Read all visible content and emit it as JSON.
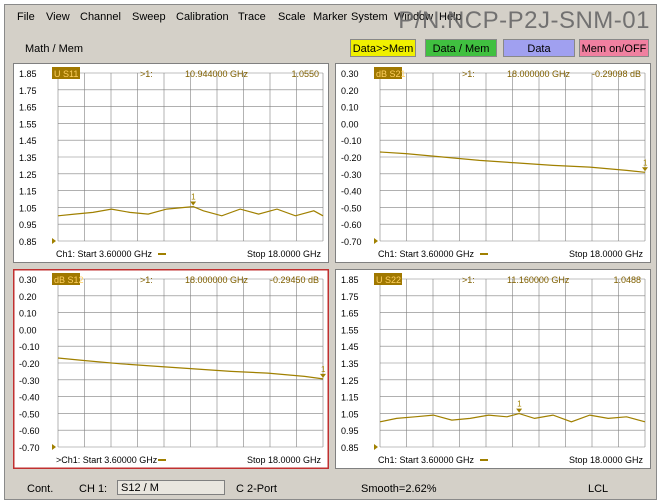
{
  "menu": [
    "File",
    "View",
    "Channel",
    "Sweep",
    "Calibration",
    "Trace",
    "Scale",
    "Marker",
    "System",
    "Window",
    "Help"
  ],
  "watermark": "P/N:NCP-P2J-SNM-01",
  "toolbar": {
    "label": "Math / Mem",
    "buttons": [
      {
        "label": "Data>>Mem",
        "color": "#f0f000"
      },
      {
        "label": "Data / Mem",
        "color": "#40c040"
      },
      {
        "label": "Data",
        "color": "#a0a0f0"
      },
      {
        "label": "Mem on/OFF",
        "color": "#f080a0"
      }
    ]
  },
  "panels": [
    {
      "trace_label": "U S11",
      "marker_text": ">1:",
      "marker_freq": "10.944000 GHz",
      "marker_value": "1.0550",
      "y_ticks": [
        "1.85",
        "1.75",
        "1.65",
        "1.55",
        "1.45",
        "1.35",
        "1.25",
        "1.15",
        "1.05",
        "0.95",
        "0.85"
      ],
      "start": "Ch1: Start  3.60000 GHz",
      "stop": "Stop  18.0000 GHz",
      "selected": false,
      "trace": {
        "x": [
          3.6,
          4.5,
          5.5,
          6.5,
          7.5,
          8.5,
          9.5,
          10.5,
          10.944,
          11.5,
          12.5,
          13.5,
          14.5,
          15.5,
          16.5,
          17.5,
          18.0
        ],
        "y": [
          1.0,
          1.01,
          1.02,
          1.04,
          1.02,
          1.01,
          1.04,
          1.05,
          1.055,
          1.03,
          1.0,
          1.04,
          1.01,
          1.04,
          1.0,
          1.03,
          1.0
        ]
      },
      "ylim": [
        0.85,
        1.85
      ],
      "marker_x": 10.944
    },
    {
      "trace_label": "dB S21",
      "marker_text": ">1:",
      "marker_freq": "18.000000 GHz",
      "marker_value": "-0.29098 dB",
      "y_ticks": [
        "0.30",
        "0.20",
        "0.10",
        "0.00",
        "-0.10",
        "-0.20",
        "-0.30",
        "-0.40",
        "-0.50",
        "-0.60",
        "-0.70"
      ],
      "start": "Ch1: Start  3.60000 GHz",
      "stop": "Stop  18.0000 GHz",
      "selected": false,
      "trace": {
        "x": [
          3.6,
          5,
          7,
          9,
          11,
          13,
          15,
          17,
          18.0
        ],
        "y": [
          -0.17,
          -0.18,
          -0.2,
          -0.22,
          -0.235,
          -0.25,
          -0.26,
          -0.28,
          -0.291
        ]
      },
      "ylim": [
        -0.7,
        0.3
      ],
      "marker_x": 18.0
    },
    {
      "trace_label": "dB S12",
      "marker_text": ">1:",
      "marker_freq": "18.000000 GHz",
      "marker_value": "-0.29450 dB",
      "y_ticks": [
        "0.30",
        "0.20",
        "0.10",
        "0.00",
        "-0.10",
        "-0.20",
        "-0.30",
        "-0.40",
        "-0.50",
        "-0.60",
        "-0.70"
      ],
      "start": ">Ch1: Start  3.60000 GHz",
      "stop": "Stop  18.0000 GHz",
      "selected": true,
      "trace": {
        "x": [
          3.6,
          5,
          7,
          9,
          11,
          13,
          15,
          17,
          18.0
        ],
        "y": [
          -0.17,
          -0.185,
          -0.205,
          -0.22,
          -0.235,
          -0.25,
          -0.26,
          -0.28,
          -0.2945
        ]
      },
      "ylim": [
        -0.7,
        0.3
      ],
      "marker_x": 18.0
    },
    {
      "trace_label": "U S22",
      "marker_text": ">1:",
      "marker_freq": "11.160000 GHz",
      "marker_value": "1.0488",
      "y_ticks": [
        "1.85",
        "1.75",
        "1.65",
        "1.55",
        "1.45",
        "1.35",
        "1.25",
        "1.15",
        "1.05",
        "0.95",
        "0.85"
      ],
      "start": "Ch1: Start  3.60000 GHz",
      "stop": "Stop  18.0000 GHz",
      "selected": false,
      "trace": {
        "x": [
          3.6,
          4.5,
          5.5,
          6.5,
          7.5,
          8.5,
          9.5,
          10.5,
          11.16,
          12.0,
          13.0,
          14.0,
          15.0,
          16.0,
          17.0,
          18.0
        ],
        "y": [
          1.0,
          1.02,
          1.03,
          1.04,
          1.01,
          1.02,
          1.04,
          1.03,
          1.049,
          1.02,
          1.04,
          1.0,
          1.04,
          1.02,
          1.03,
          1.0
        ]
      },
      "ylim": [
        0.85,
        1.85
      ],
      "marker_x": 11.16
    }
  ],
  "status": {
    "mode": "Cont.",
    "channel": "CH 1:",
    "param": "S12 / M",
    "cal": "C  2-Port",
    "smooth": "Smooth=2.62%",
    "remote": "LCL"
  },
  "colors": {
    "trace": "#a08000",
    "marker_bg": "#a07800",
    "grid": "#808080",
    "selected": "#c03030"
  }
}
